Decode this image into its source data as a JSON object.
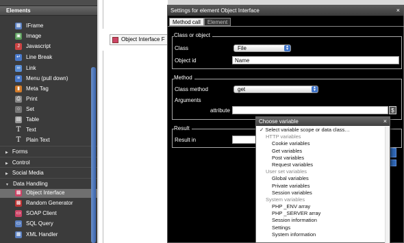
{
  "sidebar": {
    "header": "Elements",
    "items": [
      {
        "label": "IFrame",
        "icon": "iframe-icon",
        "glyph": "▦",
        "color": "#5a7fc0"
      },
      {
        "label": "Image",
        "icon": "image-icon",
        "glyph": "▣",
        "color": "#5a9c5a"
      },
      {
        "label": "Javascript",
        "icon": "javascript-icon",
        "glyph": "J",
        "color": "#c44"
      },
      {
        "label": "Line Break",
        "icon": "line-break-icon",
        "glyph": "↵",
        "color": "#4a7acb"
      },
      {
        "label": "Link",
        "icon": "link-icon",
        "glyph": "∞",
        "color": "#5a8ed6"
      },
      {
        "label": "Menu (pull down)",
        "icon": "menu-icon",
        "glyph": "≡",
        "color": "#4a7acb"
      },
      {
        "label": "Meta Tag",
        "icon": "meta-tag-icon",
        "glyph": "▮",
        "color": "#d47c2a"
      },
      {
        "label": "Print",
        "icon": "print-icon",
        "glyph": "⎙",
        "color": "#888"
      },
      {
        "label": "Set",
        "icon": "set-icon",
        "glyph": "○",
        "color": "#777"
      },
      {
        "label": "Table",
        "icon": "table-icon",
        "glyph": "▤",
        "color": "#999"
      },
      {
        "label": "Text",
        "icon": "text-icon",
        "glyph": "T",
        "color": "transparent"
      },
      {
        "label": "Plain Text",
        "icon": "plain-text-icon",
        "glyph": "T",
        "color": "transparent"
      }
    ],
    "groups": [
      "Forms",
      "Control",
      "Social Media",
      "Data Handling"
    ],
    "data_items": [
      {
        "label": "Object Interface",
        "icon": "object-interface-icon",
        "glyph": "▩",
        "color": "#c46"
      },
      {
        "label": "Random Generator",
        "icon": "random-generator-icon",
        "glyph": "▩",
        "color": "#b33"
      },
      {
        "label": "SOAP Client",
        "icon": "soap-client-icon",
        "glyph": "▭",
        "color": "#c46"
      },
      {
        "label": "SQL Query",
        "icon": "sql-query-icon",
        "glyph": "▭",
        "color": "#5a7fc0"
      },
      {
        "label": "XML Handler",
        "icon": "xml-handler-icon",
        "glyph": "▦",
        "color": "#5a7fc0"
      }
    ]
  },
  "canvas": {
    "object_label": "Object Interface F"
  },
  "dialog": {
    "title": "Settings for element Object Interface",
    "close": "×",
    "tabs": [
      "Method call",
      "Element"
    ],
    "class_section": {
      "legend": "Class or object",
      "class_label": "Class",
      "class_value": "File",
      "object_id_label": "Object id",
      "object_id_value": "Name"
    },
    "method_section": {
      "legend": "Method",
      "method_label": "Class method",
      "method_value": "get",
      "arguments_label": "Arguments",
      "attribute_label": "attribute",
      "attribute_value": "",
      "variable_button": "$"
    },
    "result_section": {
      "legend": "Result",
      "result_label": "Result in"
    }
  },
  "popup": {
    "title": "Choose variable",
    "close": "×",
    "items": [
      {
        "type": "first",
        "label": "✓ Select variable scope or data class…"
      },
      {
        "type": "grp",
        "label": "HTTP variables"
      },
      {
        "type": "opt",
        "label": "Cookie variables"
      },
      {
        "type": "opt",
        "label": "Get variables"
      },
      {
        "type": "opt",
        "label": "Post variables"
      },
      {
        "type": "opt",
        "label": "Request variables"
      },
      {
        "type": "grp",
        "label": "User set variables"
      },
      {
        "type": "opt",
        "label": "Global variables"
      },
      {
        "type": "opt",
        "label": "Private variables"
      },
      {
        "type": "opt",
        "label": "Session variables"
      },
      {
        "type": "grp",
        "label": "System variables"
      },
      {
        "type": "opt",
        "label": "PHP _ENV array"
      },
      {
        "type": "opt",
        "label": "PHP _SERVER array"
      },
      {
        "type": "opt",
        "label": "Session information"
      },
      {
        "type": "opt",
        "label": "Settings"
      },
      {
        "type": "opt",
        "label": "System information"
      }
    ]
  }
}
